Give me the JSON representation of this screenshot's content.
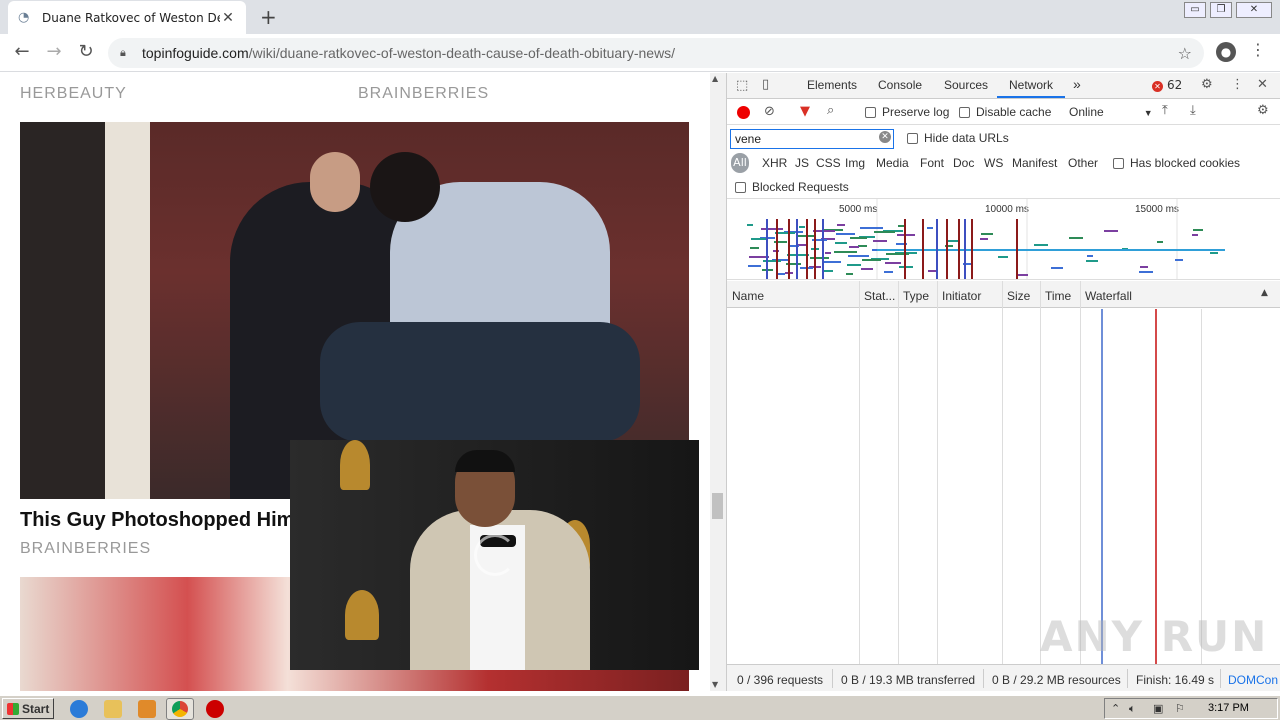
{
  "browser": {
    "tab_title": "Duane Ratkovec of Weston Death -",
    "new_tab": "+",
    "tab_close": "✕",
    "url_host": "topinfoguide.com",
    "url_path": "/wiki/duane-ratkovec-of-weston-death-cause-of-death-obituary-news/",
    "window_buttons": [
      "▭",
      "❐",
      "✕"
    ]
  },
  "page": {
    "source_left": "HERBEAUTY",
    "source_right": "BRAINBERRIES",
    "headline": "This Guy Photoshopped Hims",
    "headline_source": "BRAINBERRIES"
  },
  "devtools": {
    "tabs": [
      "Elements",
      "Console",
      "Sources",
      "Network"
    ],
    "active_tab": "Network",
    "more": "»",
    "error_count": "62",
    "preserve_log": "Preserve log",
    "disable_cache": "Disable cache",
    "throttle": "Online",
    "filter_value": "vene",
    "hide_data_urls": "Hide data URLs",
    "types": [
      "All",
      "XHR",
      "JS",
      "CSS",
      "Img",
      "Media",
      "Font",
      "Doc",
      "WS",
      "Manifest",
      "Other"
    ],
    "has_blocked_cookies": "Has blocked cookies",
    "blocked_requests": "Blocked Requests",
    "overview_ticks": [
      "5000 ms",
      "10000 ms",
      "15000 ms"
    ],
    "columns": [
      "Name",
      "Stat...",
      "Type",
      "Initiator",
      "Size",
      "Time",
      "Waterfall"
    ],
    "status": {
      "requests": "0 / 396 requests",
      "transferred": "0 B / 19.3 MB transferred",
      "resources": "0 B / 29.2 MB resources",
      "finish": "Finish: 16.49 s",
      "domcon": "DOMCon"
    }
  },
  "taskbar": {
    "start": "Start",
    "clock": "3:17 PM"
  },
  "watermark": "ANY RUN",
  "colors": {
    "accent": "#1a73e8",
    "record": "#ee0000",
    "domcontent_line": "#6f8fd8",
    "load_line": "#d44a4a"
  }
}
